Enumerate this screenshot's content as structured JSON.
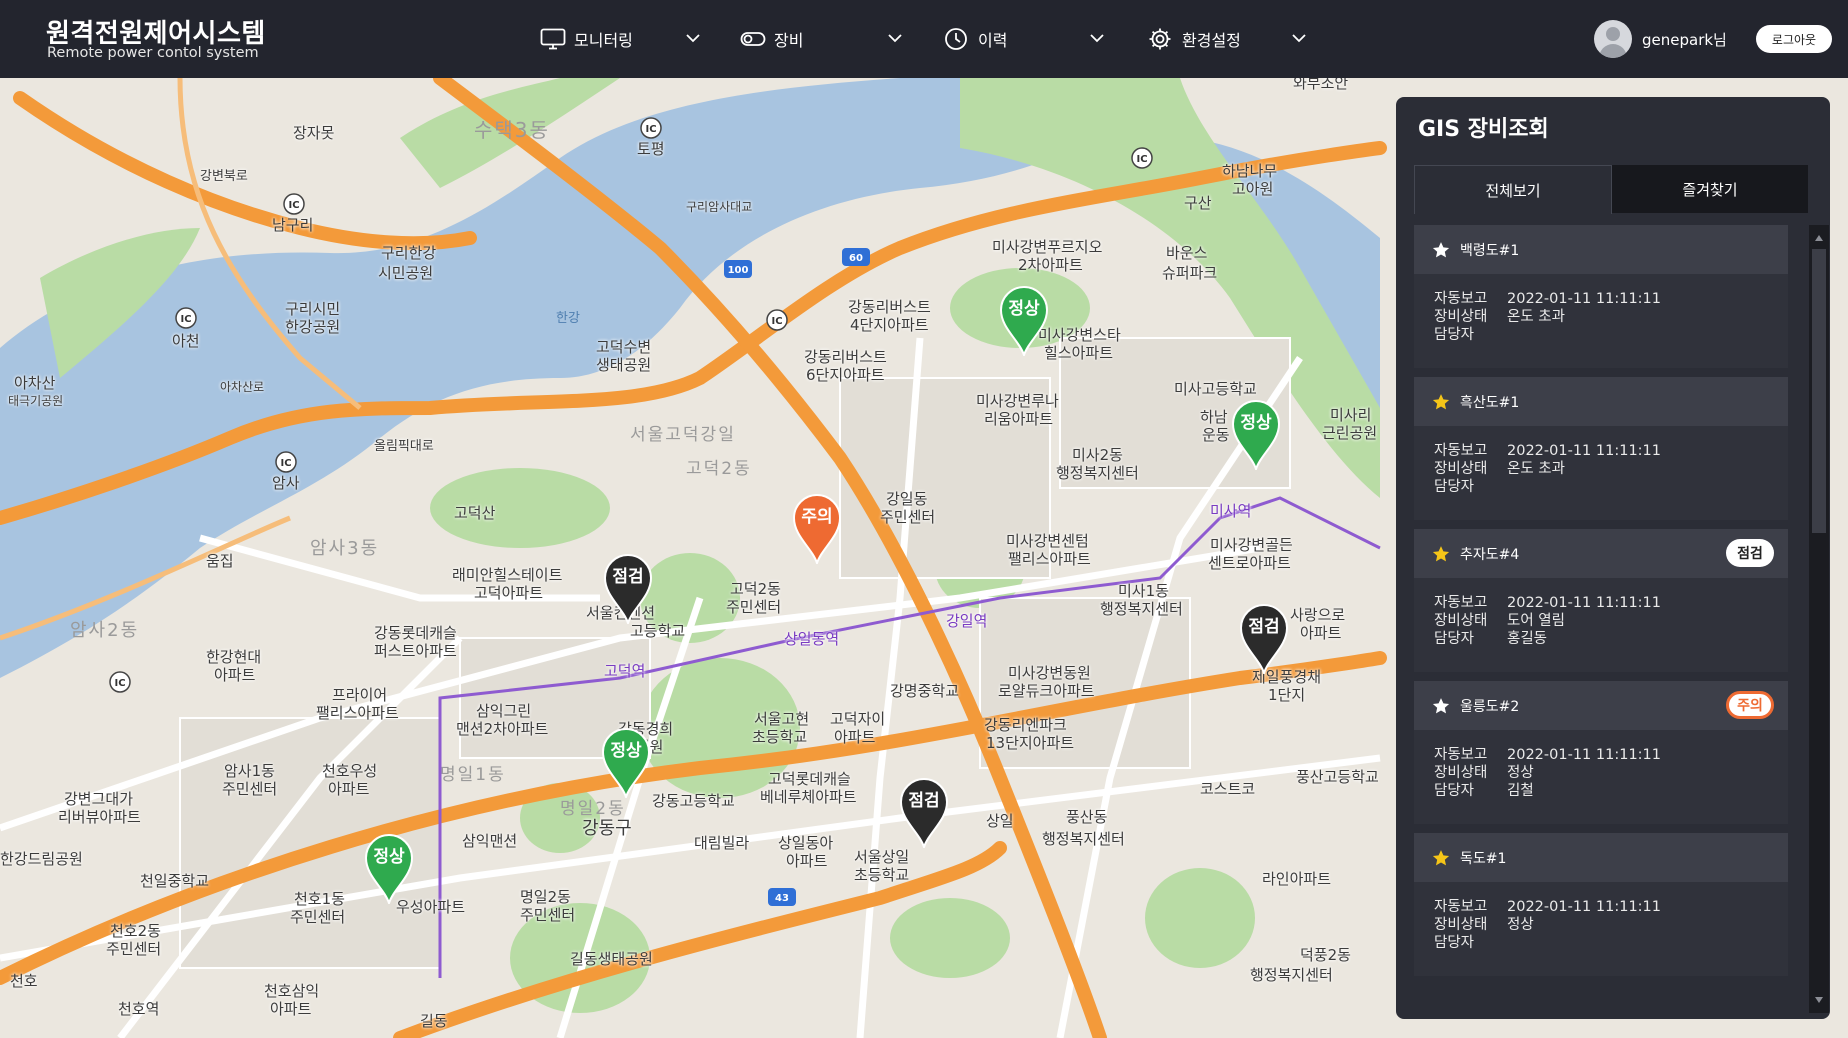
{
  "header": {
    "title": "원격전원제어시스템",
    "subtitle": "Remote power contol system",
    "nav": [
      {
        "label": "모니터링",
        "icon": "monitor-icon"
      },
      {
        "label": "장비",
        "icon": "toggle-icon"
      },
      {
        "label": "이력",
        "icon": "clock-icon"
      },
      {
        "label": "환경설정",
        "icon": "gear-icon"
      }
    ],
    "user": "genepark님",
    "logout": "로그아웃"
  },
  "map": {
    "labels": [
      "와부조안",
      "장자못",
      "수택3동",
      "토평",
      "남구리",
      "구리한강",
      "시민공원",
      "구리시민",
      "한강공원",
      "아천",
      "아차산",
      "태극기공원",
      "하남나무",
      "고아원",
      "구산",
      "바운스",
      "슈퍼파크",
      "미사강변푸르지오",
      "2차아파트",
      "강동리버스트",
      "4단지아파트",
      "강동리버스트",
      "6단지아파트",
      "고덕수변",
      "생태공원",
      "미사강변스타",
      "힐스아파트",
      "미사고등학교",
      "미사강변루나",
      "리움아파트",
      "미사리",
      "근린공원",
      "하남",
      "운동",
      "서울고덕강일",
      "고덕2동",
      "미사2동",
      "행정복지센터",
      "강일동",
      "주민센터",
      "고덕산",
      "암사",
      "미사강변센텀",
      "팰리스아파트",
      "미사강변골든",
      "센트로아파트",
      "래미안힐스테이트",
      "고덕아파트",
      "고덕2동",
      "주민센터",
      "미사1동",
      "행정복지센터",
      "사랑으로",
      "아파트",
      "암사3동",
      "움집",
      "강동롯데캐슬",
      "퍼스트아파트",
      "서울컨벤션",
      "고등학교",
      "암사2동",
      "한강현대",
      "아파트",
      "상일동역",
      "강일역",
      "고덕역",
      "미사역",
      "제일풍경채",
      "1단지",
      "프라이어",
      "팰리스아파트",
      "삼익그린",
      "맨션2차아파트",
      "강명중학교",
      "미사강변동원",
      "로얄듀크아파트",
      "강동리엔파크",
      "13단지아파트",
      "암사1동",
      "주민센터",
      "천호우성",
      "아파트",
      "강동경희",
      "대병원",
      "서울고현",
      "초등학교",
      "고덕자이",
      "아파트",
      "고덕롯데캐슬",
      "베네루체아파트",
      "코스트코",
      "풍산고등학교",
      "강변그대가",
      "리버뷰아파트",
      "명일1동",
      "강동고등학교",
      "명일2동",
      "강동구",
      "삼익맨션",
      "대림빌라",
      "상일동아",
      "아파트",
      "서울상일",
      "초등학교",
      "상일",
      "풍산동",
      "행정복지센터",
      "한강드림공원",
      "천일중학교",
      "천호1동",
      "주민센터",
      "우성아파트",
      "명일2동",
      "주민센터",
      "천호2동",
      "주민센터",
      "라인아파트",
      "길동생태공원",
      "덕풍2동",
      "행정복지센터",
      "천호",
      "천호역",
      "천호삼익",
      "아파트",
      "길동",
      "올림픽대로",
      "강변북로",
      "구리암사대교",
      "아차산로",
      "한강"
    ],
    "markers": [
      {
        "label": "정상",
        "status": "normal"
      },
      {
        "label": "정상",
        "status": "normal"
      },
      {
        "label": "주의",
        "status": "warning"
      },
      {
        "label": "점검",
        "status": "inspect"
      },
      {
        "label": "점검",
        "status": "inspect"
      },
      {
        "label": "정상",
        "status": "normal"
      },
      {
        "label": "점검",
        "status": "inspect"
      },
      {
        "label": "정상",
        "status": "normal"
      }
    ],
    "road_shields": [
      "IC",
      "IC",
      "IC",
      "IC",
      "IC",
      "IC",
      "IC",
      "100",
      "60",
      "43"
    ]
  },
  "panel": {
    "title": "GIS 장비조회",
    "tabs": [
      "전체보기",
      "즐겨찾기"
    ],
    "field_labels": {
      "report": "자동보고",
      "status": "장비상태",
      "manager": "담당자"
    },
    "items": [
      {
        "name": "백령도#1",
        "star": "white",
        "badge": "",
        "report": "2022-01-11  11:11:11",
        "status": "온도 초과",
        "manager": ""
      },
      {
        "name": "흑산도#1",
        "star": "yellow",
        "badge": "",
        "report": "2022-01-11  11:11:11",
        "status": "온도 초과",
        "manager": ""
      },
      {
        "name": "추자도#4",
        "star": "yellow",
        "badge": "점검",
        "badge_type": "check",
        "report": "2022-01-11  11:11:11",
        "status": "도어 열림",
        "manager": "홍길동"
      },
      {
        "name": "울릉도#2",
        "star": "white",
        "badge": "주의",
        "badge_type": "warn",
        "report": "2022-01-11  11:11:11",
        "status": "정상",
        "manager": "김철"
      },
      {
        "name": "독도#1",
        "star": "yellow",
        "badge": "",
        "report": "2022-01-11  11:11:11",
        "status": "정상",
        "manager": ""
      }
    ]
  },
  "colors": {
    "header_bg": "#23252e",
    "panel_bg": "#2b2d36",
    "normal": "#2faa4e",
    "warning": "#ee6a32",
    "inspect": "#2b2b2b",
    "star_yellow": "#f5c518",
    "road_orange": "#f39a3a",
    "river": "#a8c4e0",
    "park": "#a9d59a"
  }
}
